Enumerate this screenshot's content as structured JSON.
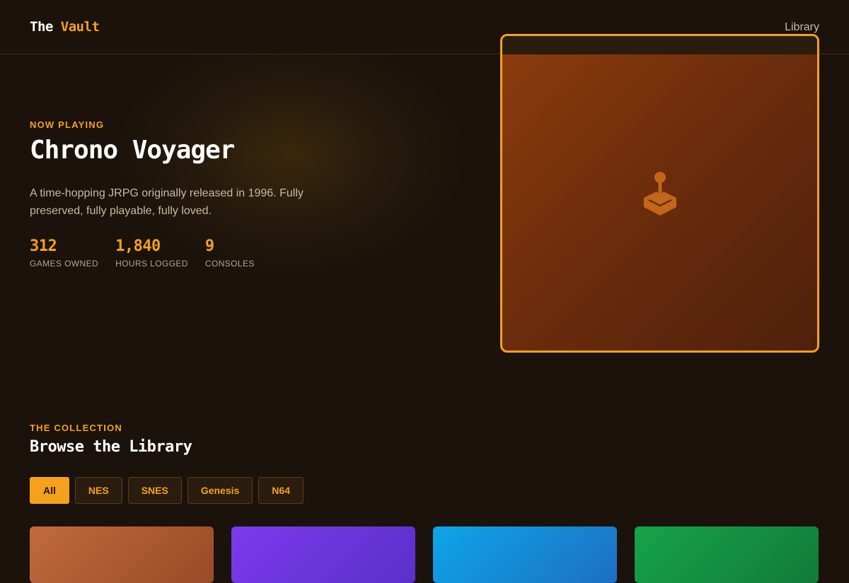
{
  "header": {
    "logo_primary": "The",
    "logo_accent": "Vault",
    "nav_link": "Library"
  },
  "hero": {
    "eyebrow": "NOW PLAYING",
    "title": "Chrono Voyager",
    "description": "A time-hopping JRPG originally released in 1996. Fully preserved, fully playable, fully loved.",
    "stats": [
      {
        "value": "312",
        "label": "GAMES OWNED"
      },
      {
        "value": "1,840",
        "label": "HOURS LOGGED"
      },
      {
        "value": "9",
        "label": "CONSOLES"
      }
    ],
    "cover_icon": "joystick-icon"
  },
  "collection": {
    "eyebrow": "THE COLLECTION",
    "title": "Browse the Library",
    "filters": [
      {
        "label": "All",
        "active": true
      },
      {
        "label": "NES",
        "active": false
      },
      {
        "label": "SNES",
        "active": false
      },
      {
        "label": "Genesis",
        "active": false
      },
      {
        "label": "N64",
        "active": false
      }
    ],
    "games": [
      {
        "color_from": "#c06a3e",
        "color_to": "#9a4a26"
      },
      {
        "color_from": "#7c3aed",
        "color_to": "#5b2fc9"
      },
      {
        "color_from": "#0ea5e9",
        "color_to": "#1d6fc2"
      },
      {
        "color_from": "#16a34a",
        "color_to": "#127a3a"
      }
    ]
  },
  "colors": {
    "background": "#1a120b",
    "accent": "#f5a11b",
    "text_muted": "#c9b9a1"
  }
}
